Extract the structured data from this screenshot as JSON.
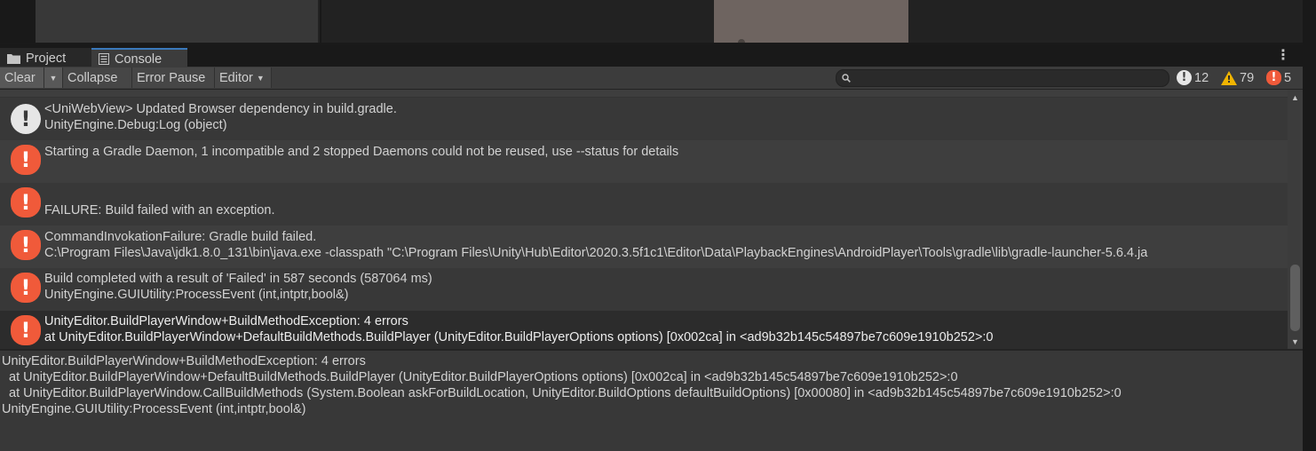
{
  "tabs": [
    {
      "label": "Project"
    },
    {
      "label": "Console"
    }
  ],
  "toolbar": {
    "clear_label": "Clear",
    "collapse_label": "Collapse",
    "error_pause_label": "Error Pause",
    "editor_label": "Editor",
    "search_placeholder": ""
  },
  "counters": {
    "info": "12",
    "warning": "79",
    "error": "5"
  },
  "colors": {
    "error_icon": "#f05a3a",
    "warning_icon": "#f0b400",
    "info_icon": "#e6e6e6",
    "active_tab_accent": "#3a79bb"
  },
  "logs": [
    {
      "type": "info",
      "icon": "info-icon",
      "line1": "<UniWebView> Updated Browser dependency in build.gradle.",
      "line2": "UnityEngine.Debug:Log (object)"
    },
    {
      "type": "error",
      "icon": "error-icon",
      "line1": "Starting a Gradle Daemon, 1 incompatible and 2 stopped Daemons could not be reused, use --status for details",
      "line2": ""
    },
    {
      "type": "error",
      "icon": "error-icon",
      "line1": "",
      "line2": "FAILURE: Build failed with an exception."
    },
    {
      "type": "error",
      "icon": "error-icon",
      "line1": "CommandInvokationFailure: Gradle build failed.",
      "line2": "C:\\Program Files\\Java\\jdk1.8.0_131\\bin\\java.exe -classpath \"C:\\Program Files\\Unity\\Hub\\Editor\\2020.3.5f1c1\\Editor\\Data\\PlaybackEngines\\AndroidPlayer\\Tools\\gradle\\lib\\gradle-launcher-5.6.4.ja"
    },
    {
      "type": "error",
      "icon": "error-icon",
      "line1": "Build completed with a result of 'Failed' in 587 seconds (587064 ms)",
      "line2": "UnityEngine.GUIUtility:ProcessEvent (int,intptr,bool&)"
    },
    {
      "type": "error",
      "icon": "error-icon",
      "line1": "UnityEditor.BuildPlayerWindow+BuildMethodException: 4 errors",
      "line2": "  at UnityEditor.BuildPlayerWindow+DefaultBuildMethods.BuildPlayer (UnityEditor.BuildPlayerOptions options) [0x002ca] in <ad9b32b145c54897be7c609e1910b252>:0"
    }
  ],
  "detail": {
    "lines": [
      "UnityEditor.BuildPlayerWindow+BuildMethodException: 4 errors",
      "  at UnityEditor.BuildPlayerWindow+DefaultBuildMethods.BuildPlayer (UnityEditor.BuildPlayerOptions options) [0x002ca] in <ad9b32b145c54897be7c609e1910b252>:0",
      "  at UnityEditor.BuildPlayerWindow.CallBuildMethods (System.Boolean askForBuildLocation, UnityEditor.BuildOptions defaultBuildOptions) [0x00080] in <ad9b32b145c54897be7c609e1910b252>:0",
      "UnityEngine.GUIUtility:ProcessEvent (int,intptr,bool&)"
    ]
  }
}
